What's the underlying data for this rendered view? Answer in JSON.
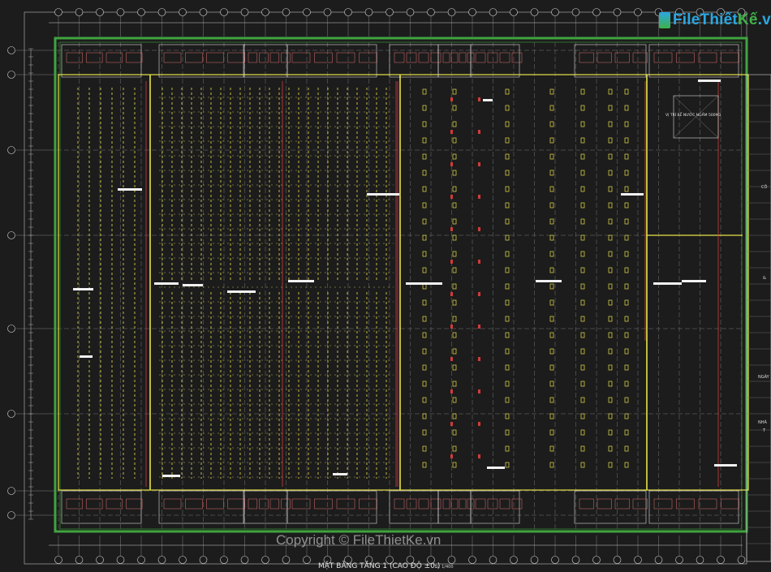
{
  "logo": {
    "brand_a": "File",
    "brand_b": "Thiết",
    "brand_c": "Kế",
    "brand_d": ".vn"
  },
  "watermark": "Copyright © FileThietKe.vn",
  "drawing_title": "MẶT BẰNG TẦNG 1 (CAO ĐỘ ±0.)",
  "scale_label": "TL: 1/400",
  "plan_note": "VỊ TRÍ BỂ NƯỚC NGẦM 500M3",
  "title_block": {
    "lines": [
      "CÔ",
      "&",
      "NGÀY",
      "NHÀ",
      "T"
    ]
  },
  "colors": {
    "background": "#1c1c1c",
    "border_green": "#3fa43f",
    "wall_yellow": "#e8e34a",
    "column_red": "#d23a3a",
    "grid_white": "#d9d9d9"
  }
}
